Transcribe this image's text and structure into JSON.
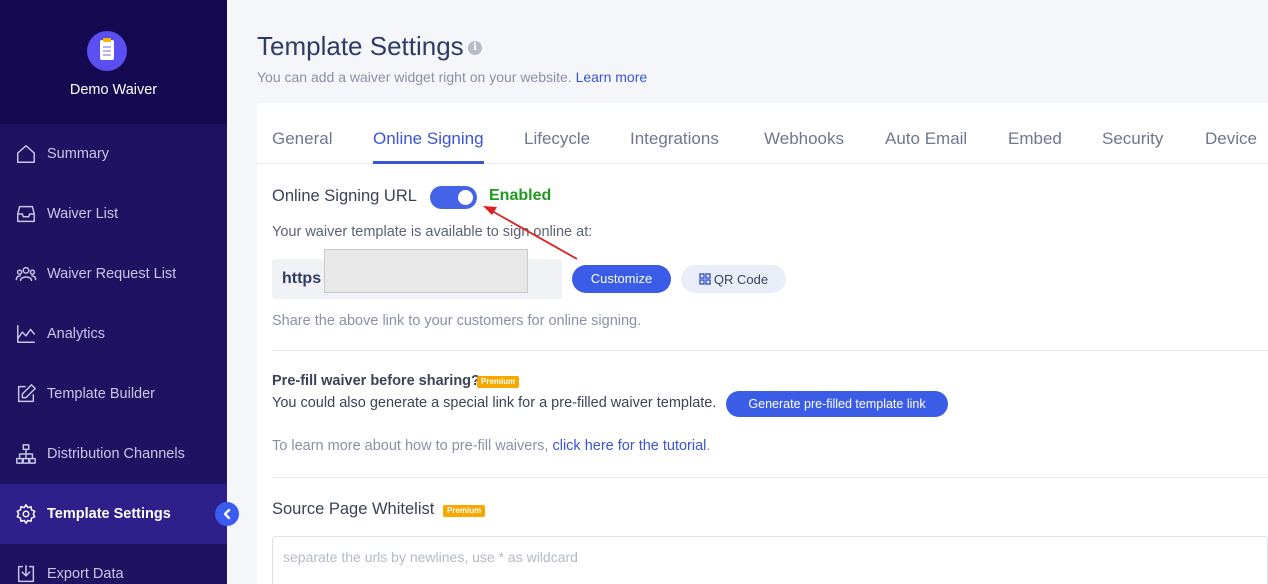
{
  "sidebar": {
    "brand_name": "Demo Waiver",
    "items": [
      {
        "label": "Summary",
        "icon": "home-icon"
      },
      {
        "label": "Waiver List",
        "icon": "inbox-icon"
      },
      {
        "label": "Waiver Request List",
        "icon": "users-icon"
      },
      {
        "label": "Analytics",
        "icon": "chart-icon"
      },
      {
        "label": "Template Builder",
        "icon": "edit-icon"
      },
      {
        "label": "Distribution Channels",
        "icon": "sitemap-icon"
      },
      {
        "label": "Template Settings",
        "icon": "gear-icon",
        "active": true
      },
      {
        "label": "Export Data",
        "icon": "download-icon"
      }
    ]
  },
  "header": {
    "title": "Template Settings",
    "subtitle": "You can add a waiver widget right on your website.",
    "learn_more": "Learn more"
  },
  "tabs": [
    "General",
    "Online Signing",
    "Lifecycle",
    "Integrations",
    "Webhooks",
    "Auto Email",
    "Embed",
    "Security",
    "Device"
  ],
  "active_tab": "Online Signing",
  "online_signing": {
    "label": "Online Signing URL",
    "status": "Enabled",
    "available_text": "Your waiver template is available to sign online at:",
    "url_prefix": "https",
    "customize_label": "Customize",
    "qr_label": "QR Code",
    "share_text": "Share the above link to your customers for online signing."
  },
  "prefill": {
    "title": "Pre-fill waiver before sharing?",
    "badge": "Premium",
    "description": "You could also generate a special link for a pre-filled waiver template.",
    "button_label": "Generate pre-filled template link",
    "tutorial_prefix": "To learn more about how to pre-fill waivers,",
    "tutorial_link": "click here for the tutorial",
    "tutorial_suffix": "."
  },
  "whitelist": {
    "title": "Source Page Whitelist",
    "badge": "Premium",
    "placeholder": "separate the urls by newlines, use * as wildcard",
    "value": ""
  },
  "colors": {
    "sidebar_bg": "#1f1361",
    "accent": "#3b5ce6",
    "enabled_green": "#1f9a1f",
    "premium": "#f6a800"
  }
}
